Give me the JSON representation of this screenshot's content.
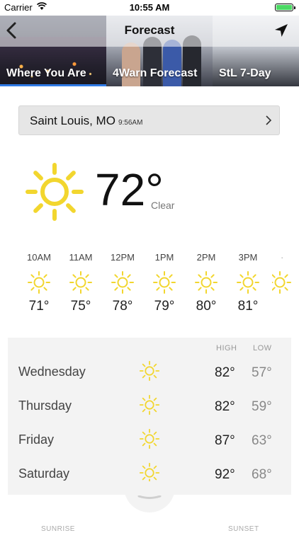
{
  "status_bar": {
    "carrier": "Carrier",
    "time": "10:55 AM"
  },
  "nav": {
    "title": "Forecast"
  },
  "tabs": [
    {
      "label": "Where You Are",
      "active": true
    },
    {
      "label": "4Warn Forecast",
      "active": false
    },
    {
      "label": "StL 7-Day",
      "active": false
    }
  ],
  "location": {
    "name": "Saint Louis, MO",
    "updated": "9:56AM"
  },
  "current": {
    "temp": "72°",
    "condition": "Clear",
    "icon": "sun-icon"
  },
  "hourly": [
    {
      "time": "10AM",
      "temp": "71°",
      "icon": "sun-icon"
    },
    {
      "time": "11AM",
      "temp": "75°",
      "icon": "sun-icon"
    },
    {
      "time": "12PM",
      "temp": "78°",
      "icon": "sun-icon"
    },
    {
      "time": "1PM",
      "temp": "79°",
      "icon": "sun-icon"
    },
    {
      "time": "2PM",
      "temp": "80°",
      "icon": "sun-icon"
    },
    {
      "time": "3PM",
      "temp": "81°",
      "icon": "sun-icon"
    }
  ],
  "daily": {
    "high_label": "HIGH",
    "low_label": "LOW",
    "days": [
      {
        "day": "Wednesday",
        "high": "82°",
        "low": "57°",
        "icon": "sun-icon"
      },
      {
        "day": "Thursday",
        "high": "82°",
        "low": "59°",
        "icon": "sun-icon"
      },
      {
        "day": "Friday",
        "high": "87°",
        "low": "63°",
        "icon": "sun-icon"
      },
      {
        "day": "Saturday",
        "high": "92°",
        "low": "68°",
        "icon": "sun-icon"
      }
    ]
  },
  "footer": {
    "sunrise_label": "SUNRISE",
    "sunset_label": "SUNSET"
  },
  "colors": {
    "accent": "#2f7ae5",
    "sun": "#f2d62e",
    "battery": "#4cd964"
  }
}
